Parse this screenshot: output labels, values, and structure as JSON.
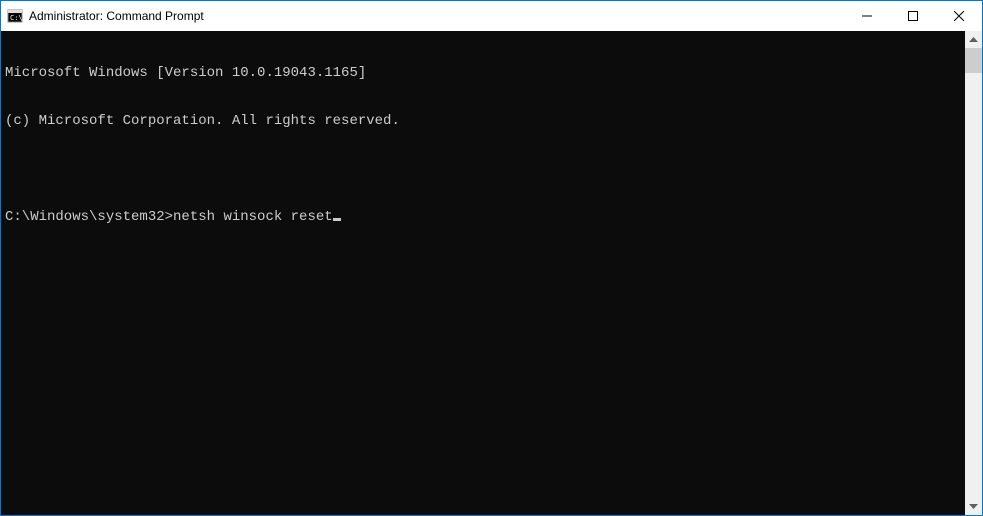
{
  "window": {
    "title": "Administrator: Command Prompt"
  },
  "terminal": {
    "line1": "Microsoft Windows [Version 10.0.19043.1165]",
    "line2": "(c) Microsoft Corporation. All rights reserved.",
    "prompt": "C:\\Windows\\system32>",
    "command": "netsh winsock reset"
  }
}
